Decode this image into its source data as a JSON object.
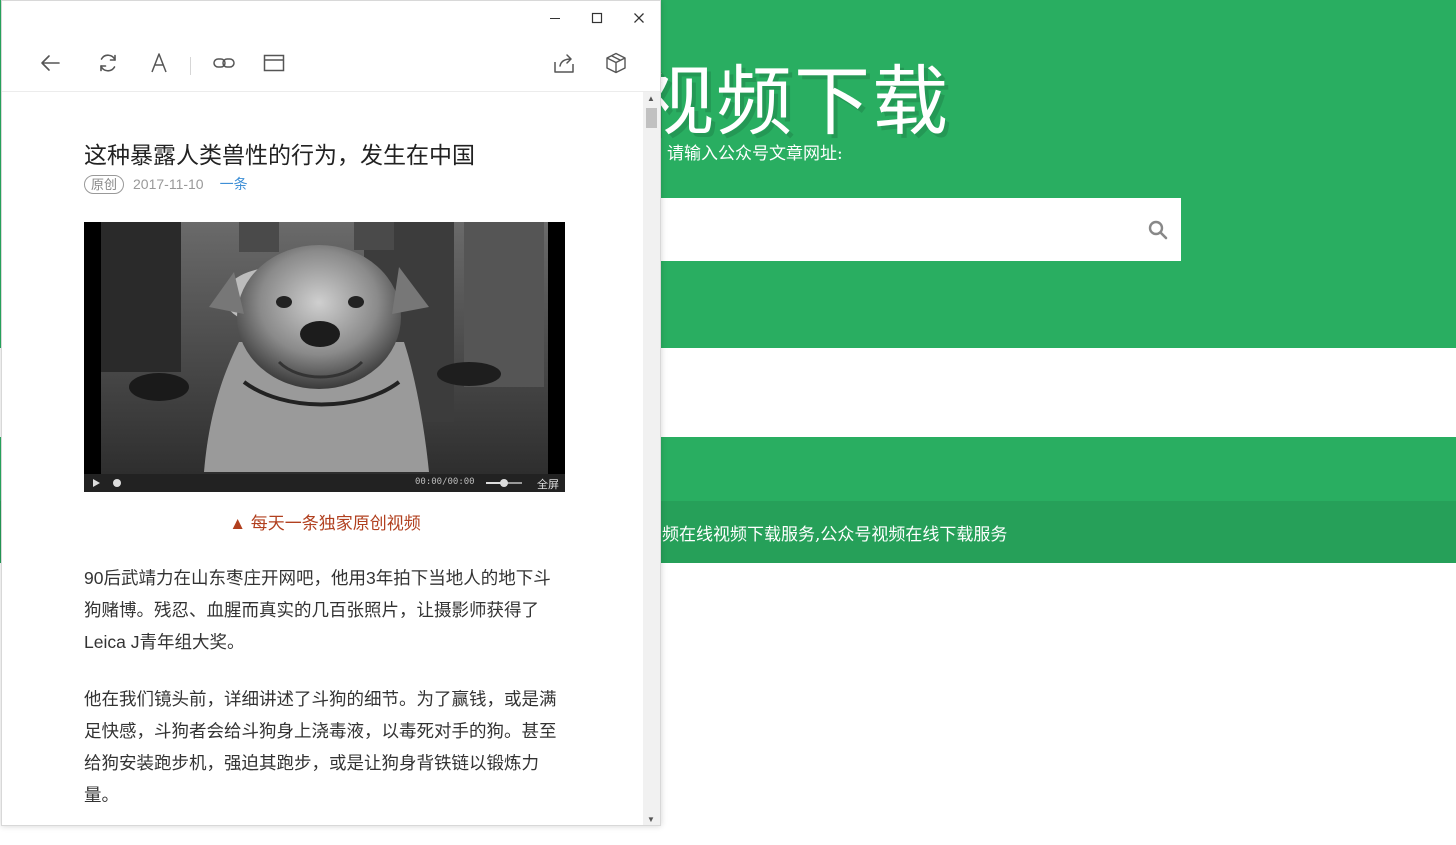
{
  "background_page": {
    "title": "信视频下载",
    "prompt": "请输入公众号文章网址:",
    "search": {
      "placeholder": "",
      "icon": "search-icon"
    },
    "footer_text": "频在线视频下载服务,公众号视频在线下载服务",
    "colors": {
      "brand": "#29ae61",
      "footer": "#26a059"
    }
  },
  "window_controls": [
    "minimize-icon",
    "maximize-icon",
    "close-icon"
  ],
  "toolbar": {
    "buttons": [
      "back-icon",
      "refresh-icon",
      "font-icon",
      "link-icon",
      "window-icon",
      "share-icon",
      "box-icon"
    ]
  },
  "article": {
    "title": "这种暴露人类兽性的行为，发生在中国",
    "badge": "原创",
    "date": "2017-11-10",
    "author": "一条",
    "video": {
      "time": "00:00/00:00",
      "fullscreen": "全屏"
    },
    "caption": "▲ 每天一条独家原创视频",
    "paragraphs": [
      "90后武靖力在山东枣庄开网吧，他用3年拍下当地人的地下斗狗赌博。残忍、血腥而真实的几百张照片，让摄影师获得了Leica J青年组大奖。",
      "他在我们镜头前，详细讲述了斗狗的细节。为了赢钱，或是满足快感，斗狗者会给斗狗身上浇毒液，以毒死对手的狗。甚至给狗安装跑步机，强迫其跑步，或是让狗身背铁链以锻炼力量。"
    ],
    "caption_color": "#b1401f"
  }
}
